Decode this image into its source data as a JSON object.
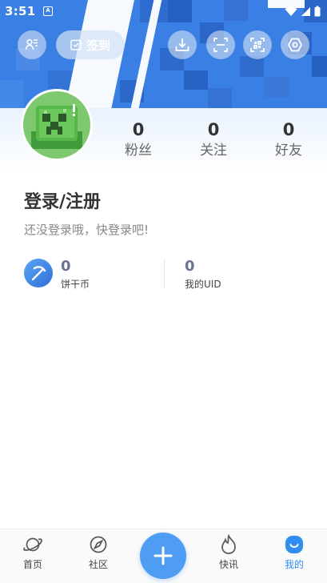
{
  "status_bar": {
    "time": "3:51",
    "notification_glyph": "A"
  },
  "header": {
    "signin_label": "签到",
    "icons": [
      "contacts-icon",
      "signin-icon",
      "download-icon",
      "scan-icon",
      "qr-code-icon",
      "settings-icon"
    ]
  },
  "profile": {
    "stats": [
      {
        "value": "0",
        "label": "粉丝"
      },
      {
        "value": "0",
        "label": "关注"
      },
      {
        "value": "0",
        "label": "好友"
      }
    ],
    "login_title": "登录/注册",
    "login_subtitle": "还没登录哦，快登录吧!"
  },
  "info": {
    "coins_value": "0",
    "coins_label": "饼干币",
    "uid_value": "0",
    "uid_label": "我的UID"
  },
  "bottom_nav": {
    "items": [
      {
        "label": "首页",
        "icon": "planet-icon"
      },
      {
        "label": "社区",
        "icon": "compass-icon"
      },
      {
        "label": "快讯",
        "icon": "flame-icon"
      },
      {
        "label": "我的",
        "icon": "profile-face-icon"
      }
    ],
    "active_index": 3,
    "center_button_icon": "plus-icon"
  },
  "colors": {
    "accent": "#2f8ef0",
    "banner_blue": "#3f85e6",
    "avatar_green": "#7ec96f"
  }
}
